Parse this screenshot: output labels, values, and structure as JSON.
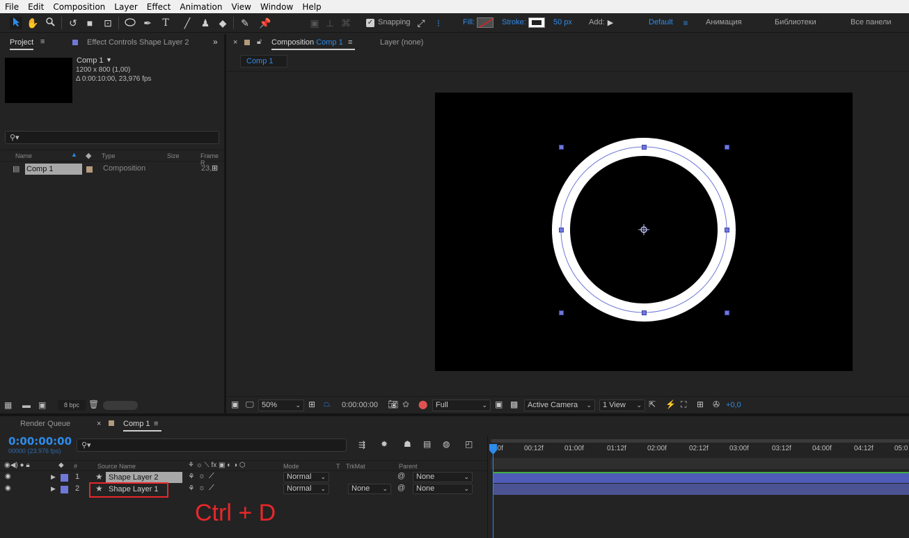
{
  "menu": [
    "File",
    "Edit",
    "Composition",
    "Layer",
    "Effect",
    "Animation",
    "View",
    "Window",
    "Help"
  ],
  "toolbar": {
    "snapping_label": "Snapping",
    "fill_label": "Fill:",
    "stroke_label": "Stroke:",
    "stroke_px": "50 px",
    "add_label": "Add:",
    "workspaces": [
      "Default",
      "Анимация",
      "Библиотеки",
      "Все панели"
    ]
  },
  "project_panel": {
    "tab_project": "Project",
    "tab_effect_controls": "Effect Controls Shape Layer 2",
    "comp_name": "Comp 1",
    "comp_size": "1200 x 800 (1,00)",
    "comp_duration": "Δ 0:00:10:00, 23,976 fps",
    "columns": [
      "Name",
      "Type",
      "Size",
      "Frame R"
    ],
    "item": {
      "name": "Comp 1",
      "type": "Composition",
      "frame_rate": "23,"
    },
    "bpc": "8 bpc"
  },
  "comp_panel": {
    "tab_prefix": "Composition",
    "tab_comp": "Comp 1",
    "layer_tab": "Layer (none)",
    "breadcrumb": "Comp 1",
    "zoom": "50%",
    "timecode": "0:00:00:00",
    "resolution": "Full",
    "camera": "Active Camera",
    "views": "1 View",
    "exposure": "+0,0"
  },
  "timeline": {
    "render_queue": "Render Queue",
    "comp_tab": "Comp 1",
    "timecode": "0:00:00:00",
    "frames": "00000 (23.976 fps)",
    "columns": {
      "num": "#",
      "source": "Source Name",
      "mode": "Mode",
      "t": "T",
      "trkmat": "TrkMat",
      "parent": "Parent"
    },
    "ruler": [
      "00f",
      "00:12f",
      "01:00f",
      "01:12f",
      "02:00f",
      "02:12f",
      "03:00f",
      "03:12f",
      "04:00f",
      "04:12f",
      "05:0"
    ],
    "layers": [
      {
        "num": "1",
        "name": "Shape Layer 2",
        "mode": "Normal",
        "trkmat": "",
        "parent": "None"
      },
      {
        "num": "2",
        "name": "Shape Layer 1",
        "mode": "Normal",
        "trkmat": "None",
        "parent": "None"
      }
    ]
  },
  "annotation": "Ctrl + D",
  "colors": {
    "accent": "#2d8ceb",
    "label": "#6f78d8",
    "annotation": "#e8272a",
    "comp_bg": "#000000"
  }
}
